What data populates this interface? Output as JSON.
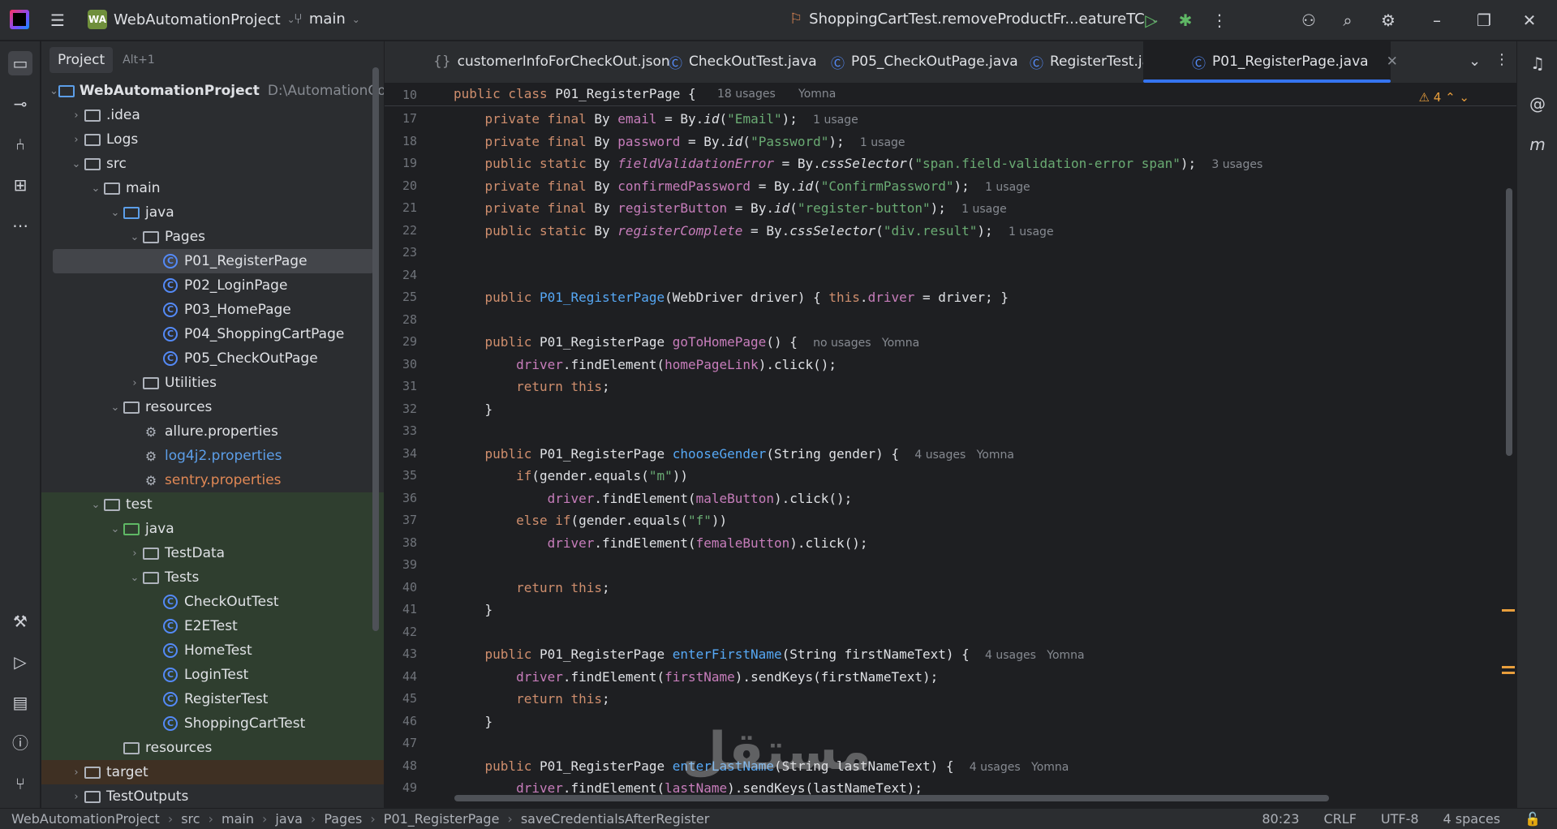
{
  "titlebar": {
    "project_badge": "WA",
    "project_name": "WebAutomationProject",
    "branch": "main",
    "run_config": "ShoppingCartTest.removeProductFr...eatureTC"
  },
  "project_panel": {
    "tab_label": "Project",
    "shortcut": "Alt+1",
    "tree": [
      {
        "label": "WebAutomationProject",
        "path": "D:\\AutomationCours",
        "indent": 0,
        "arrow": "down",
        "icon": "module"
      },
      {
        "label": ".idea",
        "indent": 1,
        "arrow": "right",
        "icon": "folder"
      },
      {
        "label": "Logs",
        "indent": 1,
        "arrow": "right",
        "icon": "folder"
      },
      {
        "label": "src",
        "indent": 1,
        "arrow": "down",
        "icon": "folder"
      },
      {
        "label": "main",
        "indent": 2,
        "arrow": "down",
        "icon": "folder"
      },
      {
        "label": "java",
        "indent": 3,
        "arrow": "down",
        "icon": "folder-blue"
      },
      {
        "label": "Pages",
        "indent": 4,
        "arrow": "down",
        "icon": "package"
      },
      {
        "label": "P01_RegisterPage",
        "indent": 5,
        "icon": "class",
        "selected": true
      },
      {
        "label": "P02_LoginPage",
        "indent": 5,
        "icon": "class"
      },
      {
        "label": "P03_HomePage",
        "indent": 5,
        "icon": "class"
      },
      {
        "label": "P04_ShoppingCartPage",
        "indent": 5,
        "icon": "class"
      },
      {
        "label": "P05_CheckOutPage",
        "indent": 5,
        "icon": "class"
      },
      {
        "label": "Utilities",
        "indent": 4,
        "arrow": "right",
        "icon": "package"
      },
      {
        "label": "resources",
        "indent": 3,
        "arrow": "down",
        "icon": "folder-res"
      },
      {
        "label": "allure.properties",
        "indent": 4,
        "icon": "gear"
      },
      {
        "label": "log4j2.properties",
        "indent": 4,
        "icon": "gear",
        "color": "blue"
      },
      {
        "label": "sentry.properties",
        "indent": 4,
        "icon": "gear",
        "color": "orange"
      },
      {
        "label": "test",
        "indent": 2,
        "arrow": "down",
        "icon": "folder",
        "bg": "green"
      },
      {
        "label": "java",
        "indent": 3,
        "arrow": "down",
        "icon": "folder-green",
        "bg": "green"
      },
      {
        "label": "TestData",
        "indent": 4,
        "arrow": "right",
        "icon": "package",
        "bg": "green"
      },
      {
        "label": "Tests",
        "indent": 4,
        "arrow": "down",
        "icon": "package",
        "bg": "green"
      },
      {
        "label": "CheckOutTest",
        "indent": 5,
        "icon": "test-class",
        "bg": "green"
      },
      {
        "label": "E2ETest",
        "indent": 5,
        "icon": "test-class",
        "bg": "green"
      },
      {
        "label": "HomeTest",
        "indent": 5,
        "icon": "test-class",
        "bg": "green"
      },
      {
        "label": "LoginTest",
        "indent": 5,
        "icon": "test-class",
        "bg": "green"
      },
      {
        "label": "RegisterTest",
        "indent": 5,
        "icon": "test-class",
        "bg": "green"
      },
      {
        "label": "ShoppingCartTest",
        "indent": 5,
        "icon": "test-class",
        "bg": "green"
      },
      {
        "label": "resources",
        "indent": 3,
        "icon": "folder-res",
        "bg": "green"
      },
      {
        "label": "target",
        "indent": 1,
        "arrow": "right",
        "icon": "folder",
        "bg": "brown"
      },
      {
        "label": "TestOutputs",
        "indent": 1,
        "arrow": "right",
        "icon": "folder"
      }
    ]
  },
  "editor_tabs": [
    {
      "label": "customerInfoForCheckOut.json",
      "icon": "json"
    },
    {
      "label": "CheckOutTest.java",
      "icon": "test-class"
    },
    {
      "label": "P05_CheckOutPage.java",
      "icon": "class"
    },
    {
      "label": "RegisterTest.java",
      "icon": "test-class"
    },
    {
      "label": "P01_RegisterPage.java",
      "icon": "class",
      "active": true
    }
  ],
  "warnings_count": "4",
  "sticky_line": {
    "num": "10",
    "code": "public class P01_RegisterPage {",
    "usages": "18 usages",
    "author": "Yomna"
  },
  "code_lines": [
    {
      "num": "17",
      "html": "    <span class='kw'>private final</span> By <span class='fld'>email</span> = By.<span class='mi'>id</span>(<span class='str'>\"Email\"</span>);  <span class='hint'>1 usage</span>"
    },
    {
      "num": "18",
      "html": "    <span class='kw'>private final</span> By <span class='fld'>password</span> = By.<span class='mi'>id</span>(<span class='str'>\"Password\"</span>);  <span class='hint'>1 usage</span>"
    },
    {
      "num": "19",
      "html": "    <span class='kw'>public static</span> By <span class='fldi'>fieldValidationError</span> = By.<span class='mi'>cssSelector</span>(<span class='str'>\"span.field-validation-error span\"</span>);  <span class='hint'>3 usages</span>"
    },
    {
      "num": "20",
      "html": "    <span class='kw'>private final</span> By <span class='fld'>confirmedPassword</span> = By.<span class='mi'>id</span>(<span class='str'>\"ConfirmPassword\"</span>);  <span class='hint'>1 usage</span>"
    },
    {
      "num": "21",
      "html": "    <span class='kw'>private final</span> By <span class='fld'>registerButton</span> = By.<span class='mi'>id</span>(<span class='str'>\"register-button\"</span>);  <span class='hint'>1 usage</span>"
    },
    {
      "num": "22",
      "html": "    <span class='kw'>public static</span> By <span class='fldi'>registerComplete</span> = By.<span class='mi'>cssSelector</span>(<span class='str'>\"div.result\"</span>);  <span class='hint'>1 usage</span>"
    },
    {
      "num": "23",
      "html": ""
    },
    {
      "num": "24",
      "html": ""
    },
    {
      "num": "25",
      "html": "    <span class='kw'>public</span> <span class='fn'>P01_RegisterPage</span>(WebDriver driver) { <span class='kw'>this</span>.<span class='fld'>driver</span> = driver; }"
    },
    {
      "num": "28",
      "html": ""
    },
    {
      "num": "29",
      "html": "    <span class='kw'>public</span> P01_RegisterPage <span class='fld'>goToHomePage</span>() {  <span class='hint'>no usages   Yomna</span>"
    },
    {
      "num": "30",
      "html": "        <span class='fld'>driver</span>.findElement(<span class='fld'>homePageLink</span>).click();"
    },
    {
      "num": "31",
      "html": "        <span class='kw'>return this</span>;"
    },
    {
      "num": "32",
      "html": "    }"
    },
    {
      "num": "33",
      "html": ""
    },
    {
      "num": "34",
      "html": "    <span class='kw'>public</span> P01_RegisterPage <span class='fn'>chooseGender</span>(String gender) {  <span class='hint'>4 usages   Yomna</span>"
    },
    {
      "num": "35",
      "html": "        <span class='kw'>if</span>(gender.equals(<span class='str'>\"m\"</span>))"
    },
    {
      "num": "36",
      "html": "            <span class='fld'>driver</span>.findElement(<span class='fld'>maleButton</span>).click();"
    },
    {
      "num": "37",
      "html": "        <span class='kw'>else if</span>(gender.equals(<span class='str'>\"f\"</span>))"
    },
    {
      "num": "38",
      "html": "            <span class='fld'>driver</span>.findElement(<span class='fld'>femaleButton</span>).click();"
    },
    {
      "num": "39",
      "html": ""
    },
    {
      "num": "40",
      "html": "        <span class='kw'>return this</span>;"
    },
    {
      "num": "41",
      "html": "    }"
    },
    {
      "num": "42",
      "html": ""
    },
    {
      "num": "43",
      "html": "    <span class='kw'>public</span> P01_RegisterPage <span class='fn'>enterFirstName</span>(String firstNameText) {  <span class='hint'>4 usages   Yomna</span>"
    },
    {
      "num": "44",
      "html": "        <span class='fld'>driver</span>.findElement(<span class='fld'>firstName</span>).sendKeys(firstNameText);"
    },
    {
      "num": "45",
      "html": "        <span class='kw'>return this</span>;"
    },
    {
      "num": "46",
      "html": "    }"
    },
    {
      "num": "47",
      "html": ""
    },
    {
      "num": "48",
      "html": "    <span class='kw'>public</span> P01_RegisterPage <span class='fn'>enterLastName</span>(String lastNameText) {  <span class='hint'>4 usages   Yomna</span>"
    },
    {
      "num": "49",
      "html": "        <span class='fld'>driver</span>.findElement(<span class='fld'>lastName</span>).sendKeys(lastNameText);"
    }
  ],
  "statusbar": {
    "crumbs": [
      "WebAutomationProject",
      "src",
      "main",
      "java",
      "Pages",
      "P01_RegisterPage",
      "saveCredentialsAfterRegister"
    ],
    "position": "80:23",
    "line_sep": "CRLF",
    "encoding": "UTF-8",
    "indent": "4 spaces"
  },
  "watermark": "مستقل"
}
